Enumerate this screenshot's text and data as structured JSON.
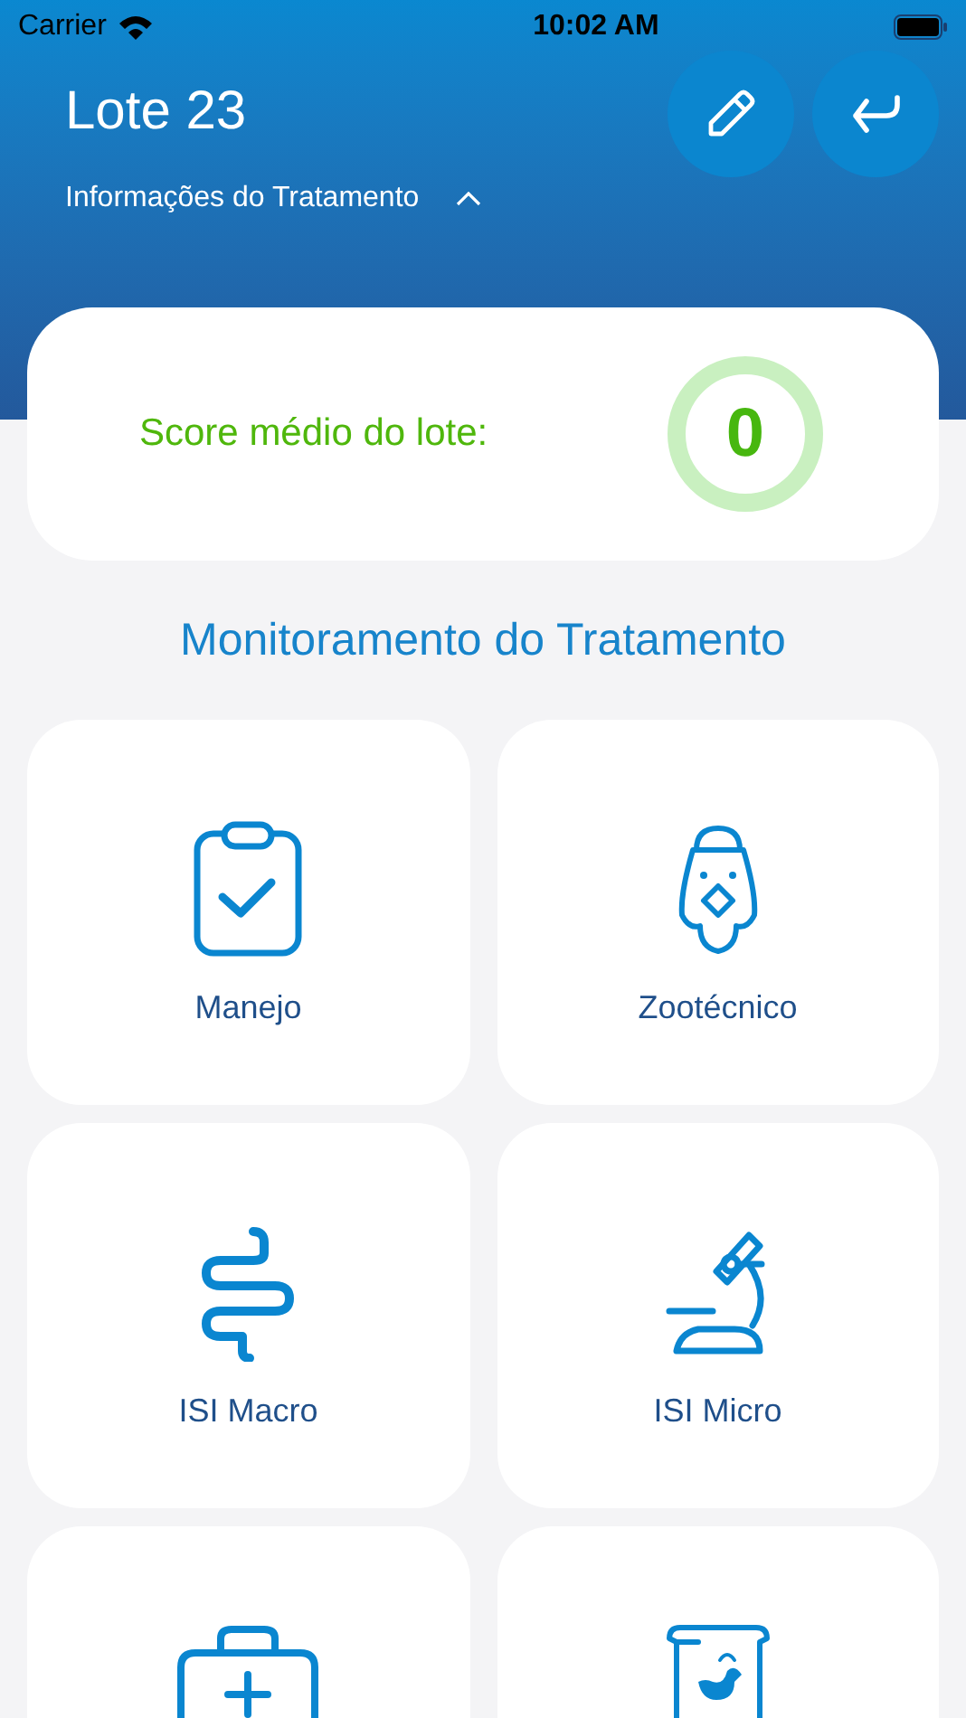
{
  "status_bar": {
    "carrier": "Carrier",
    "time": "10:02 AM"
  },
  "header": {
    "title": "Lote 23",
    "subtitle": "Informações do Tratamento",
    "expanded": true
  },
  "score": {
    "label": "Score médio do lote:",
    "value": "0"
  },
  "section_title": "Monitoramento do Tratamento",
  "tiles": [
    {
      "label": "Manejo"
    },
    {
      "label": "Zootécnico"
    },
    {
      "label": "ISI Macro"
    },
    {
      "label": "ISI Micro"
    },
    {
      "kind": "cut"
    },
    {
      "kind": "cut"
    }
  ]
}
